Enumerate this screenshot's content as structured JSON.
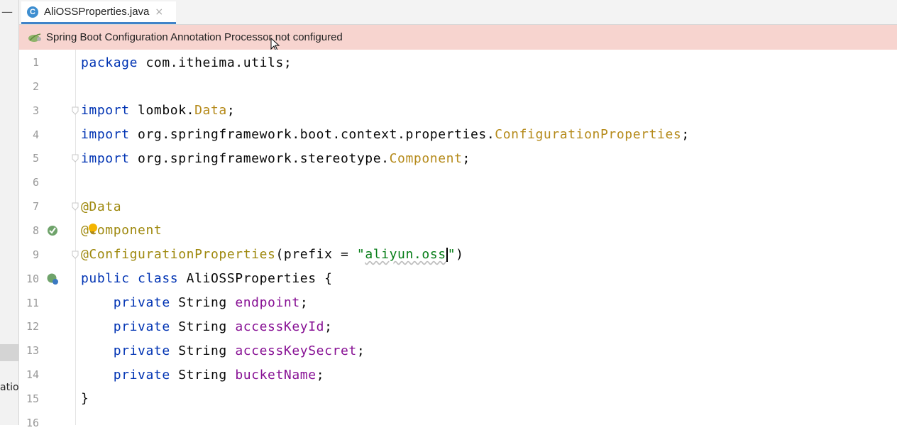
{
  "tab": {
    "icon_letter": "C",
    "filename": "AliOSSProperties.java",
    "close": "×"
  },
  "banner": {
    "text": "Spring Boot Configuration Annotation Processor not configured"
  },
  "left_panel": {
    "cut_text": "atio"
  },
  "editor": {
    "lines": [
      {
        "no": "1",
        "tokens": [
          [
            "kw",
            "package"
          ],
          [
            "pkg",
            " com.itheima.utils;"
          ]
        ]
      },
      {
        "no": "2",
        "tokens": []
      },
      {
        "no": "3",
        "tokens": [
          [
            "kw",
            "import"
          ],
          [
            "pkg",
            " lombok."
          ],
          [
            "cls",
            "Data"
          ],
          [
            "pkg",
            ";"
          ]
        ]
      },
      {
        "no": "4",
        "tokens": [
          [
            "kw",
            "import"
          ],
          [
            "pkg",
            " org.springframework.boot.context.properties."
          ],
          [
            "cls",
            "ConfigurationProperties"
          ],
          [
            "pkg",
            ";"
          ]
        ]
      },
      {
        "no": "5",
        "tokens": [
          [
            "kw",
            "import"
          ],
          [
            "pkg",
            " org.springframework.stereotype."
          ],
          [
            "cls",
            "Component"
          ],
          [
            "pkg",
            ";"
          ]
        ]
      },
      {
        "no": "6",
        "tokens": []
      },
      {
        "no": "7",
        "tokens": [
          [
            "ann",
            "@Data"
          ]
        ]
      },
      {
        "no": "8",
        "tokens": [
          [
            "ann",
            "@Component"
          ]
        ]
      },
      {
        "no": "9",
        "tokens": [
          [
            "ann",
            "@ConfigurationProperties"
          ],
          [
            "pkg",
            "(prefix = "
          ],
          [
            "str",
            "\""
          ],
          [
            "str squiggle",
            "aliyun.oss"
          ],
          [
            "caret",
            ""
          ],
          [
            "str",
            "\""
          ],
          [
            "pkg",
            ")"
          ]
        ]
      },
      {
        "no": "10",
        "tokens": [
          [
            "kw",
            "public class"
          ],
          [
            "pkg",
            " AliOSSProperties {"
          ]
        ]
      },
      {
        "no": "11",
        "tokens": [
          [
            "pkg",
            "    "
          ],
          [
            "kw",
            "private"
          ],
          [
            "pkg",
            " String "
          ],
          [
            "fld",
            "endpoint"
          ],
          [
            "pkg",
            ";"
          ]
        ]
      },
      {
        "no": "12",
        "tokens": [
          [
            "pkg",
            "    "
          ],
          [
            "kw",
            "private"
          ],
          [
            "pkg",
            " String "
          ],
          [
            "fld",
            "accessKeyId"
          ],
          [
            "pkg",
            ";"
          ]
        ]
      },
      {
        "no": "13",
        "tokens": [
          [
            "pkg",
            "    "
          ],
          [
            "kw",
            "private"
          ],
          [
            "pkg",
            " String "
          ],
          [
            "fld",
            "accessKeySecret"
          ],
          [
            "pkg",
            ";"
          ]
        ]
      },
      {
        "no": "14",
        "tokens": [
          [
            "pkg",
            "    "
          ],
          [
            "kw",
            "private"
          ],
          [
            "pkg",
            " String "
          ],
          [
            "fld",
            "bucketName"
          ],
          [
            "pkg",
            ";"
          ]
        ]
      },
      {
        "no": "15",
        "tokens": [
          [
            "pkg",
            "}"
          ]
        ]
      },
      {
        "no": "16",
        "tokens": []
      }
    ]
  },
  "colors": {
    "keyword": "#0033b3",
    "class_ref": "#b58a1a",
    "annotation": "#9e880d",
    "field": "#871094",
    "string": "#067d17",
    "banner_bg": "#f7d4cf",
    "tab_accent": "#4083c9"
  },
  "icons": {
    "tab": "java-class-icon",
    "banner": "spring-leaf-icon",
    "line8": "spring-bean-icon",
    "line10": "spring-bean-gutter-icon",
    "bulb": "intention-bulb-icon"
  }
}
